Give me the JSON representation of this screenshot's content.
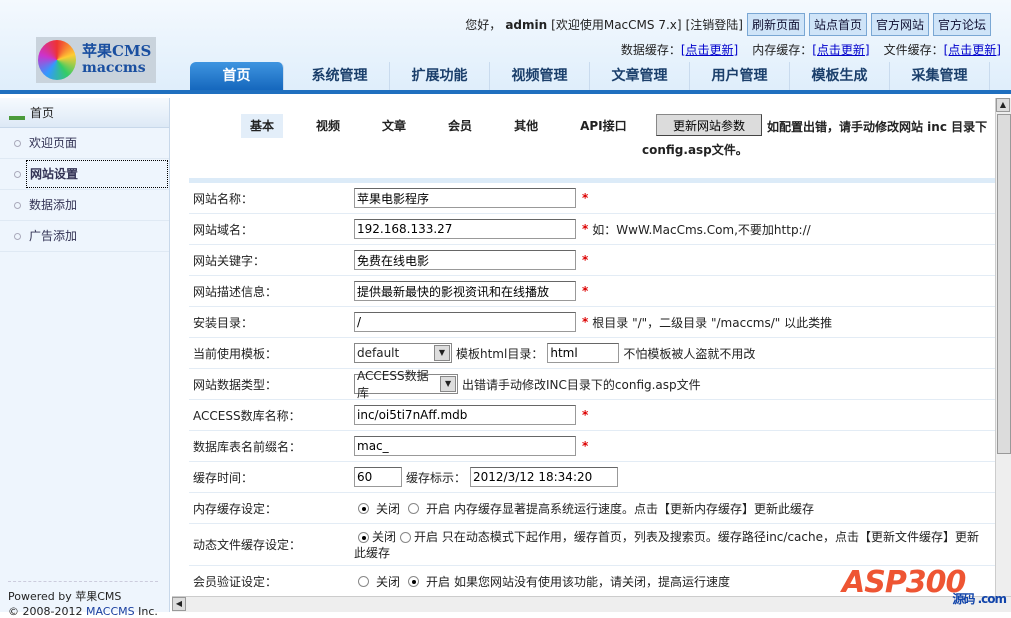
{
  "header": {
    "logo": {
      "line1": "苹果CMS",
      "line2": "maccms"
    },
    "greeting": "您好，",
    "user": "admin",
    "welcome": "[欢迎使用MacCMS  7.x]",
    "logout": "[注销登陆]",
    "buttons": [
      "刷新页面",
      "站点首页",
      "官方网站",
      "官方论坛"
    ],
    "cache": [
      {
        "label": "数据缓存：",
        "link": "[点击更新]"
      },
      {
        "label": "内存缓存：",
        "link": "[点击更新]"
      },
      {
        "label": "文件缓存：",
        "link": "[点击更新]"
      }
    ],
    "nav": [
      "首页",
      "系统管理",
      "扩展功能",
      "视频管理",
      "文章管理",
      "用户管理",
      "模板生成",
      "采集管理"
    ]
  },
  "sidebar": {
    "title": "首页",
    "items": [
      "欢迎页面",
      "网站设置",
      "数据添加",
      "广告添加"
    ],
    "powered": "Powered by 苹果CMS",
    "copyright": "© 2008-2012 ",
    "copyright_brand": "MACCMS",
    "copyright_tail": " Inc."
  },
  "main": {
    "tabs": [
      "基本",
      "视频",
      "文章",
      "会员",
      "其他",
      "API接口"
    ],
    "update_button": "更新网站参数",
    "notice": "如配置出错，请手动修改网站 inc 目录下",
    "notice2": "config.asp文件。",
    "form": {
      "site_name": {
        "label": "网站名称：",
        "value": "苹果电影程序"
      },
      "domain": {
        "label": "网站域名：",
        "value": "192.168.133.27",
        "hint": "如：WwW.MacCms.Com,不要加http://"
      },
      "keywords": {
        "label": "网站关键字：",
        "value": "免费在线电影"
      },
      "description": {
        "label": "网站描述信息：",
        "value": "提供最新最快的影视资讯和在线播放"
      },
      "install_dir": {
        "label": "安装目录：",
        "value": "/",
        "hint": "根目录 \"/\"，二级目录 \"/maccms/\" 以此类推"
      },
      "template": {
        "label": "当前使用模板：",
        "value": "default",
        "html_label": "模板html目录：",
        "html_value": "html",
        "hint": "不怕模板被人盗就不用改"
      },
      "db_type": {
        "label": "网站数据类型：",
        "value": "ACCESS数据库",
        "hint": "出错请手动修改INC目录下的config.asp文件"
      },
      "access_name": {
        "label": "ACCESS数库名称：",
        "value": "inc/oi5ti7nAff.mdb"
      },
      "table_prefix": {
        "label": "数据库表名前缀名：",
        "value": "mac_"
      },
      "cache_time": {
        "label": "缓存时间：",
        "value": "60",
        "flag_label": "缓存标示：",
        "flag_value": "2012/3/12 18:34:20"
      },
      "mem_cache": {
        "label": "内存缓存设定：",
        "off": "关闭",
        "on": "开启",
        "selected": "off",
        "hint": "内存缓存显著提高系统运行速度。点击【更新内存缓存】更新此缓存"
      },
      "file_cache": {
        "label": "动态文件缓存设定：",
        "off": "关闭",
        "on": "开启",
        "selected": "off",
        "hint": "只在动态模式下起作用，缓存首页，列表及搜索页。缓存路径inc/cache，点击【更新文件缓存】更新此缓存"
      },
      "member_verify": {
        "label": "会员验证设定：",
        "off": "关闭",
        "on": "开启",
        "selected": "on",
        "hint": "如果您网站没有使用该功能，请关闭，提高运行速度"
      }
    }
  },
  "watermark": {
    "text": "ASP300",
    "sub": "源码 .com"
  }
}
